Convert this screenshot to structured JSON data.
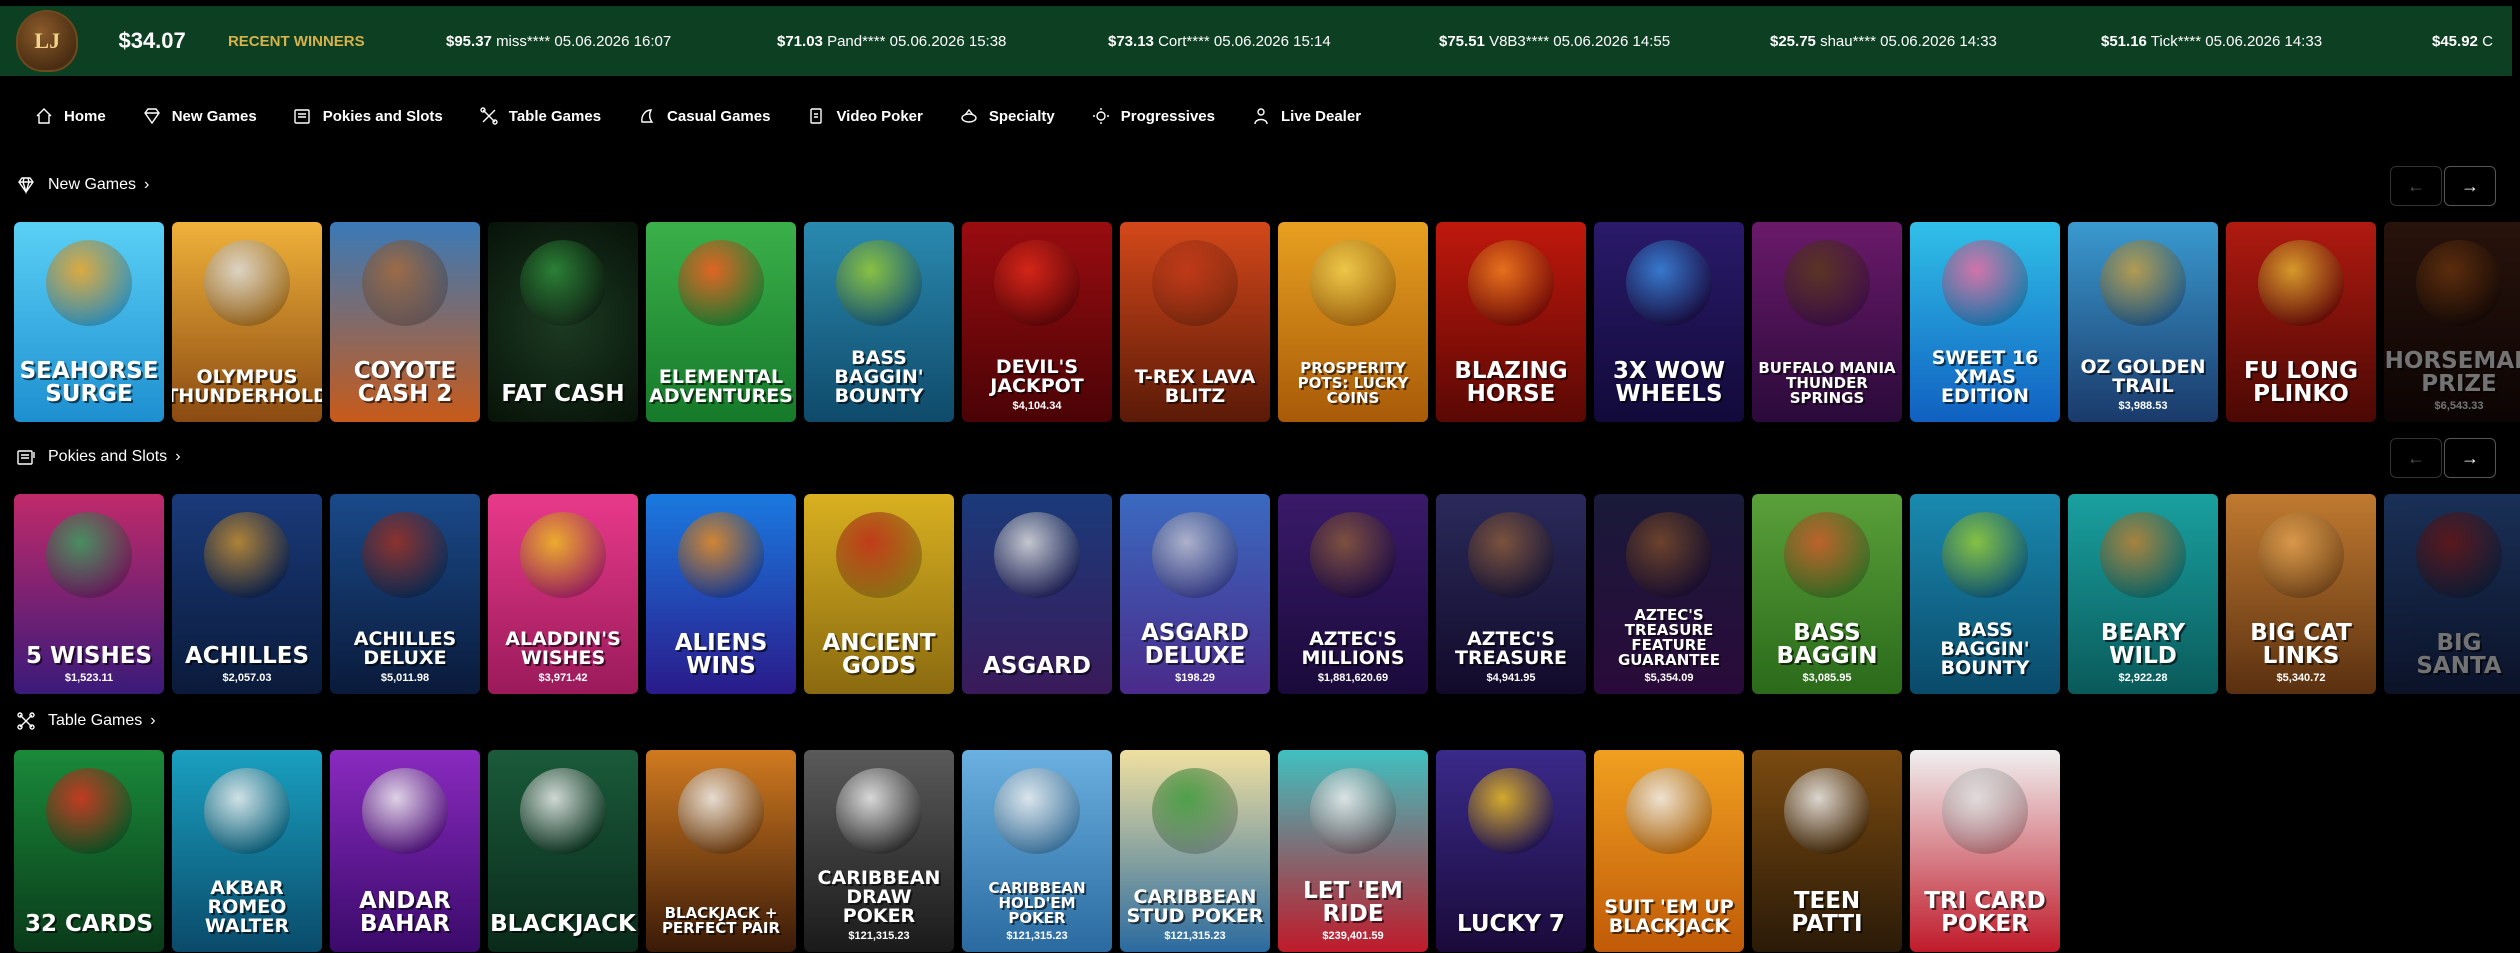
{
  "header": {
    "logo_text": "LJ",
    "balance": "$34.07",
    "recent_label": "RECENT WINNERS",
    "winners": [
      {
        "amount": "$95.37",
        "text": "miss**** 05.06.2026 16:07"
      },
      {
        "amount": "$71.03",
        "text": "Pand**** 05.06.2026 15:38"
      },
      {
        "amount": "$73.13",
        "text": "Cort**** 05.06.2026 15:14"
      },
      {
        "amount": "$75.51",
        "text": "V8B3**** 05.06.2026 14:55"
      },
      {
        "amount": "$25.75",
        "text": "shau**** 05.06.2026 14:33"
      },
      {
        "amount": "$51.16",
        "text": "Tick**** 05.06.2026 14:33"
      },
      {
        "amount": "$45.92",
        "text": "C"
      }
    ]
  },
  "nav": [
    {
      "label": "Home",
      "icon": "home-icon"
    },
    {
      "label": "New Games",
      "icon": "diamond-icon"
    },
    {
      "label": "Pokies and Slots",
      "icon": "slot-machine-icon"
    },
    {
      "label": "Table Games",
      "icon": "table-games-icon"
    },
    {
      "label": "Casual Games",
      "icon": "casual-games-icon"
    },
    {
      "label": "Video Poker",
      "icon": "video-poker-icon"
    },
    {
      "label": "Specialty",
      "icon": "specialty-icon"
    },
    {
      "label": "Progressives",
      "icon": "progressives-icon"
    },
    {
      "label": "Live Dealer",
      "icon": "live-dealer-icon"
    }
  ],
  "sections": {
    "new_games": {
      "title": "New Games",
      "prev": "←",
      "next": "→",
      "tiles": [
        {
          "name": "SEAHORSE Surge",
          "jackpot": "",
          "bg": "linear-gradient(180deg,#5ad0f5,#1d8fd0)",
          "art": "#f5a623"
        },
        {
          "name": "OLYMPUS THUNDERHOLD",
          "jackpot": "",
          "bg": "linear-gradient(180deg,#f0b23a,#8a4a12)",
          "art": "#ddd"
        },
        {
          "name": "COYOTE CASH 2",
          "jackpot": "",
          "bg": "linear-gradient(180deg,#3a7ab8,#c85a1a)",
          "art": "#a86a3a"
        },
        {
          "name": "FAT CASH",
          "jackpot": "",
          "bg": "radial-gradient(circle,#1c3a22,#071208)",
          "art": "#2f8f3c"
        },
        {
          "name": "Elemental Adventures",
          "jackpot": "",
          "bg": "linear-gradient(180deg,#3bb04a,#157a2a)",
          "art": "#ff5a1f"
        },
        {
          "name": "BASS BAGGIN' BOUNTY",
          "jackpot": "",
          "bg": "linear-gradient(180deg,#2a8ab0,#0f4a6a)",
          "art": "#9acd32"
        },
        {
          "name": "DEVIL'S JACKPOT",
          "jackpot": "$4,104.34",
          "bg": "linear-gradient(180deg,#9a0c10,#4a0306)",
          "art": "#e02a1a"
        },
        {
          "name": "T-REX LAVA BLITZ",
          "jackpot": "",
          "bg": "linear-gradient(180deg,#d4481a,#5a1a08)",
          "art": "#c0391a"
        },
        {
          "name": "PROSPERITY POTS: LUCKY COINS",
          "jackpot": "",
          "bg": "linear-gradient(180deg,#e8a020,#a85a08)",
          "art": "#f0d050"
        },
        {
          "name": "BLAZING HORSE",
          "jackpot": "",
          "bg": "linear-gradient(180deg,#c0180c,#5a0804)",
          "art": "#f08020"
        },
        {
          "name": "3x WOW WHEELS",
          "jackpot": "",
          "bg": "linear-gradient(180deg,#2a1a6a,#120a3a)",
          "art": "#3a8ae0"
        },
        {
          "name": "BUFFALO MANIA THUNDER SPRINGS",
          "jackpot": "",
          "bg": "linear-gradient(180deg,#6a1a6a,#2a0a3a)",
          "art": "#5a3a1a"
        },
        {
          "name": "SWEET 16 XMAS EDITION",
          "jackpot": "",
          "bg": "linear-gradient(180deg,#30c0e8,#1060c0)",
          "art": "#f06aa0"
        },
        {
          "name": "OZ GOLDEN TRAIL",
          "jackpot": "$3,988.53",
          "bg": "linear-gradient(180deg,#3a9ad0,#1a3a6a)",
          "art": "#c8a040"
        },
        {
          "name": "FU LONG PLINKO",
          "jackpot": "",
          "bg": "linear-gradient(180deg,#b01a10,#4a0804)",
          "art": "#e0b030"
        },
        {
          "name": "HORSEMAN PRIZE",
          "jackpot": "$6,543.33",
          "bg": "linear-gradient(180deg,#5a2a1a,#1a0a08)",
          "art": "#e07020",
          "fade": true
        }
      ]
    },
    "pokies": {
      "title": "Pokies and Slots",
      "prev": "←",
      "next": "→",
      "tiles": [
        {
          "name": "5 WISHES",
          "jackpot": "$1,523.11",
          "bg": "linear-gradient(180deg,#c02a6a,#3a1a7a)",
          "art": "#3aa060"
        },
        {
          "name": "ACHILLES",
          "jackpot": "$2,057.03",
          "bg": "linear-gradient(180deg,#1a3a7a,#0a1a3a)",
          "art": "#c89030"
        },
        {
          "name": "ACHILLES DELUXE",
          "jackpot": "$5,011.98",
          "bg": "linear-gradient(180deg,#1a4a8a,#0a1a3a)",
          "art": "#a03020"
        },
        {
          "name": "ALADDIN'S WISHES",
          "jackpot": "$3,971.42",
          "bg": "linear-gradient(180deg,#e83a8a,#9a1a5a)",
          "art": "#f0c020"
        },
        {
          "name": "ALIENS WINS",
          "jackpot": "",
          "bg": "linear-gradient(180deg,#1a7ae0,#2a1a8a)",
          "art": "#f08a1a"
        },
        {
          "name": "ANCIENT GODS",
          "jackpot": "",
          "bg": "linear-gradient(180deg,#d8b020,#8a6a10)",
          "art": "#c02a1a"
        },
        {
          "name": "ASGARD",
          "jackpot": "",
          "bg": "linear-gradient(180deg,#1a3a7a,#3a1a5a)",
          "art": "#e0e0e0"
        },
        {
          "name": "ASGARD DELUXE",
          "jackpot": "$198.29",
          "bg": "linear-gradient(180deg,#3a6ac0,#4a2a8a)",
          "art": "#c0c0d0"
        },
        {
          "name": "AZTEC'S MILLIONS",
          "jackpot": "$1,881,620.69",
          "bg": "linear-gradient(180deg,#3a1a6a,#1a0a3a)",
          "art": "#8a5a3a"
        },
        {
          "name": "AZTEC'S TREASURE",
          "jackpot": "$4,941.95",
          "bg": "linear-gradient(180deg,#2a2a5a,#120a2a)",
          "art": "#8a5a3a"
        },
        {
          "name": "AZTEC'S TREASURE FEATURE GUARANTEE",
          "jackpot": "$5,354.09",
          "bg": "linear-gradient(180deg,#1a1a3a,#2a0a3a)",
          "art": "#7a4a2a"
        },
        {
          "name": "BASS BAGGIN",
          "jackpot": "$3,085.95",
          "bg": "linear-gradient(180deg,#5aa03a,#2a6a1a)",
          "art": "#d05a2a"
        },
        {
          "name": "BASS BAGGIN' BOUNTY",
          "jackpot": "",
          "bg": "linear-gradient(180deg,#1a8ab0,#0a4a6a)",
          "art": "#9acd32"
        },
        {
          "name": "BEARY WILD",
          "jackpot": "$2,922.28",
          "bg": "linear-gradient(180deg,#1aa0a0,#0a5a5a)",
          "art": "#c08030"
        },
        {
          "name": "BIG CAT LINKS",
          "jackpot": "$5,340.72",
          "bg": "linear-gradient(180deg,#c07a30,#5a3010)",
          "art": "#e0a050"
        },
        {
          "name": "BIG SANTA",
          "jackpot": "",
          "bg": "linear-gradient(180deg,#3a6ac0,#1a2a5a)",
          "art": "#e03030",
          "fade": true
        }
      ]
    },
    "table": {
      "title": "Table Games",
      "tiles": [
        {
          "name": "32 CARDS",
          "jackpot": "",
          "bg": "linear-gradient(180deg,#1a8a3a,#0a3a1a)",
          "art": "#e03020"
        },
        {
          "name": "AKBAR ROMEO WALTER",
          "jackpot": "",
          "bg": "linear-gradient(180deg,#1aa0c0,#0a4a6a)",
          "art": "#f0f0f0"
        },
        {
          "name": "ANDAR BAHAR",
          "jackpot": "",
          "bg": "linear-gradient(180deg,#8a2ac0,#3a0a6a)",
          "art": "#f0f0f0"
        },
        {
          "name": "BLACKJACK",
          "jackpot": "",
          "bg": "linear-gradient(180deg,#1a5a3a,#0a2a1a)",
          "art": "#f0f0f0"
        },
        {
          "name": "BLACKJACK + PERFECT PAIR",
          "jackpot": "",
          "bg": "linear-gradient(180deg,#d07a20,#3a1a08)",
          "art": "#f0f0f0"
        },
        {
          "name": "CARIBBEAN DRAW POKER",
          "jackpot": "$121,315.23",
          "bg": "linear-gradient(180deg,#5a5a5a,#1a1a1a)",
          "art": "#f0f0f0"
        },
        {
          "name": "CARIBBEAN HOLD'EM POKER",
          "jackpot": "$121,315.23",
          "bg": "linear-gradient(180deg,#6ab0e0,#2a6aa0)",
          "art": "#f0f0f0"
        },
        {
          "name": "CARIBBEAN STUD POKER",
          "jackpot": "$121,315.23",
          "bg": "linear-gradient(180deg,#f0e0a0,#2a6aa0)",
          "art": "#3a9a3a"
        },
        {
          "name": "LET 'EM RIDE",
          "jackpot": "$239,401.59",
          "bg": "linear-gradient(180deg,#40c0c0,#c01a2a)",
          "art": "#f0f0f0"
        },
        {
          "name": "LUCKY 7",
          "jackpot": "",
          "bg": "linear-gradient(180deg,#3a2a8a,#1a0a3a)",
          "art": "#f0c020"
        },
        {
          "name": "SUIT 'EM UP BLACKJACK",
          "jackpot": "",
          "bg": "linear-gradient(180deg,#f0a020,#c05a08)",
          "art": "#f0f0f0"
        },
        {
          "name": "TEEN PATTI",
          "jackpot": "",
          "bg": "linear-gradient(180deg,#7a4a10,#2a1a08)",
          "art": "#f0f0f0"
        },
        {
          "name": "TRI CARD POKER",
          "jackpot": "",
          "bg": "linear-gradient(180deg,#f0f0f0,#c01a2a)",
          "art": "#e0e0e0"
        }
      ]
    }
  }
}
